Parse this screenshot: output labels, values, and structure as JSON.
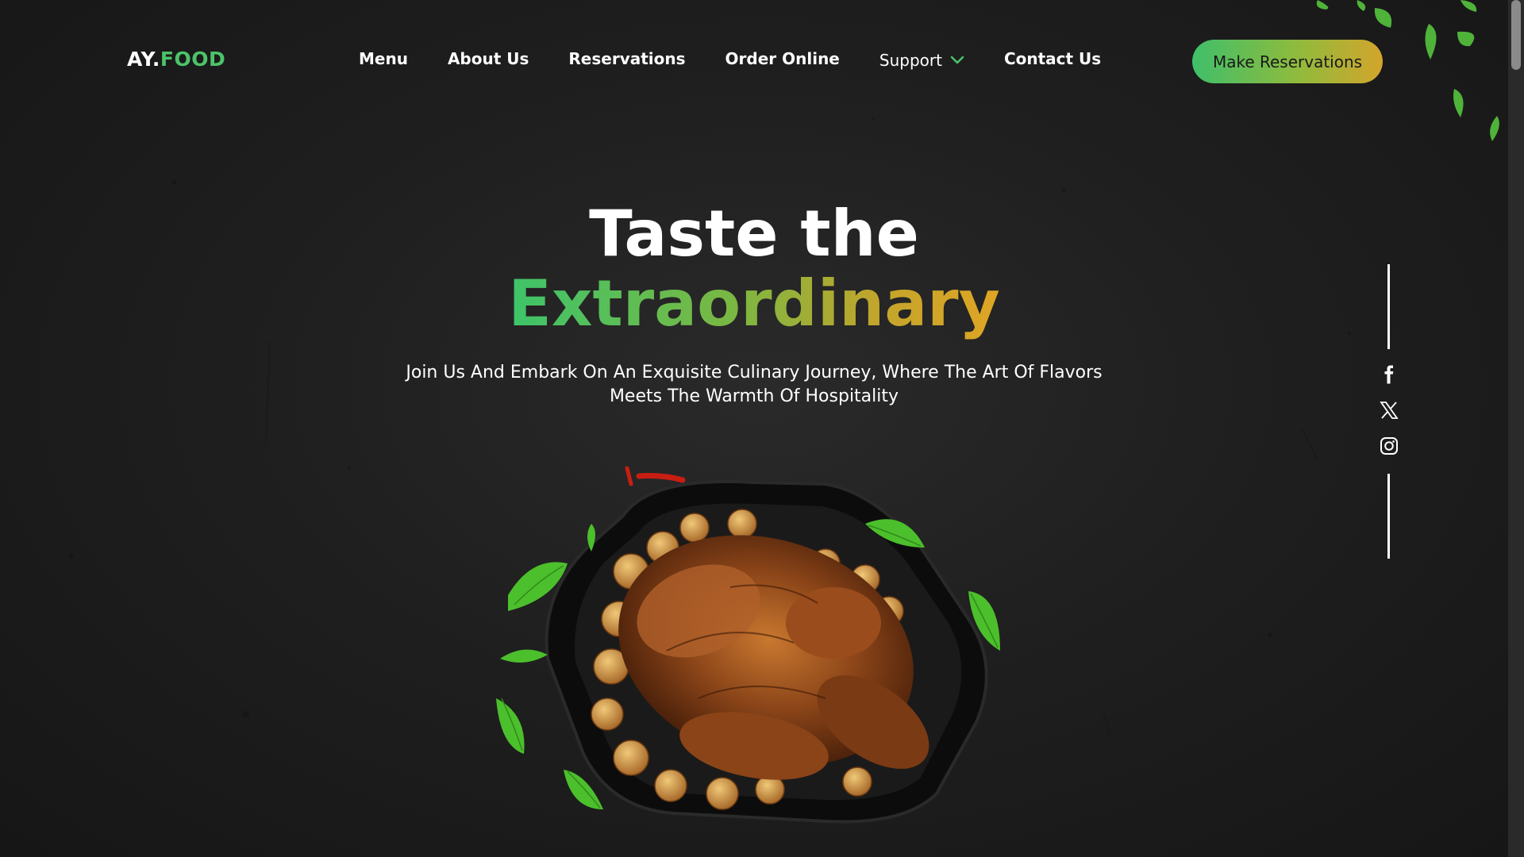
{
  "logo": {
    "part1": "AY.",
    "part2": "FOOD"
  },
  "nav": {
    "items": [
      {
        "label": "Menu"
      },
      {
        "label": "About Us"
      },
      {
        "label": "Reservations"
      },
      {
        "label": "Order Online"
      },
      {
        "label": "Support"
      },
      {
        "label": "Contact Us"
      }
    ]
  },
  "cta": {
    "label": "Make Reservations"
  },
  "hero": {
    "title_line1": "Taste the",
    "title_line2": "Extraordinary",
    "subtitle_line1": "Join Us And Embark On An Exquisite Culinary Journey, Where The Art Of Flavors",
    "subtitle_line2": "Meets The Warmth Of Hospitality"
  },
  "social": {
    "icons": [
      "facebook-icon",
      "x-icon",
      "instagram-icon"
    ]
  },
  "colors": {
    "accent_green": "#4cc36a",
    "accent_gold": "#d3a52c",
    "background": "#1c1c1c"
  }
}
